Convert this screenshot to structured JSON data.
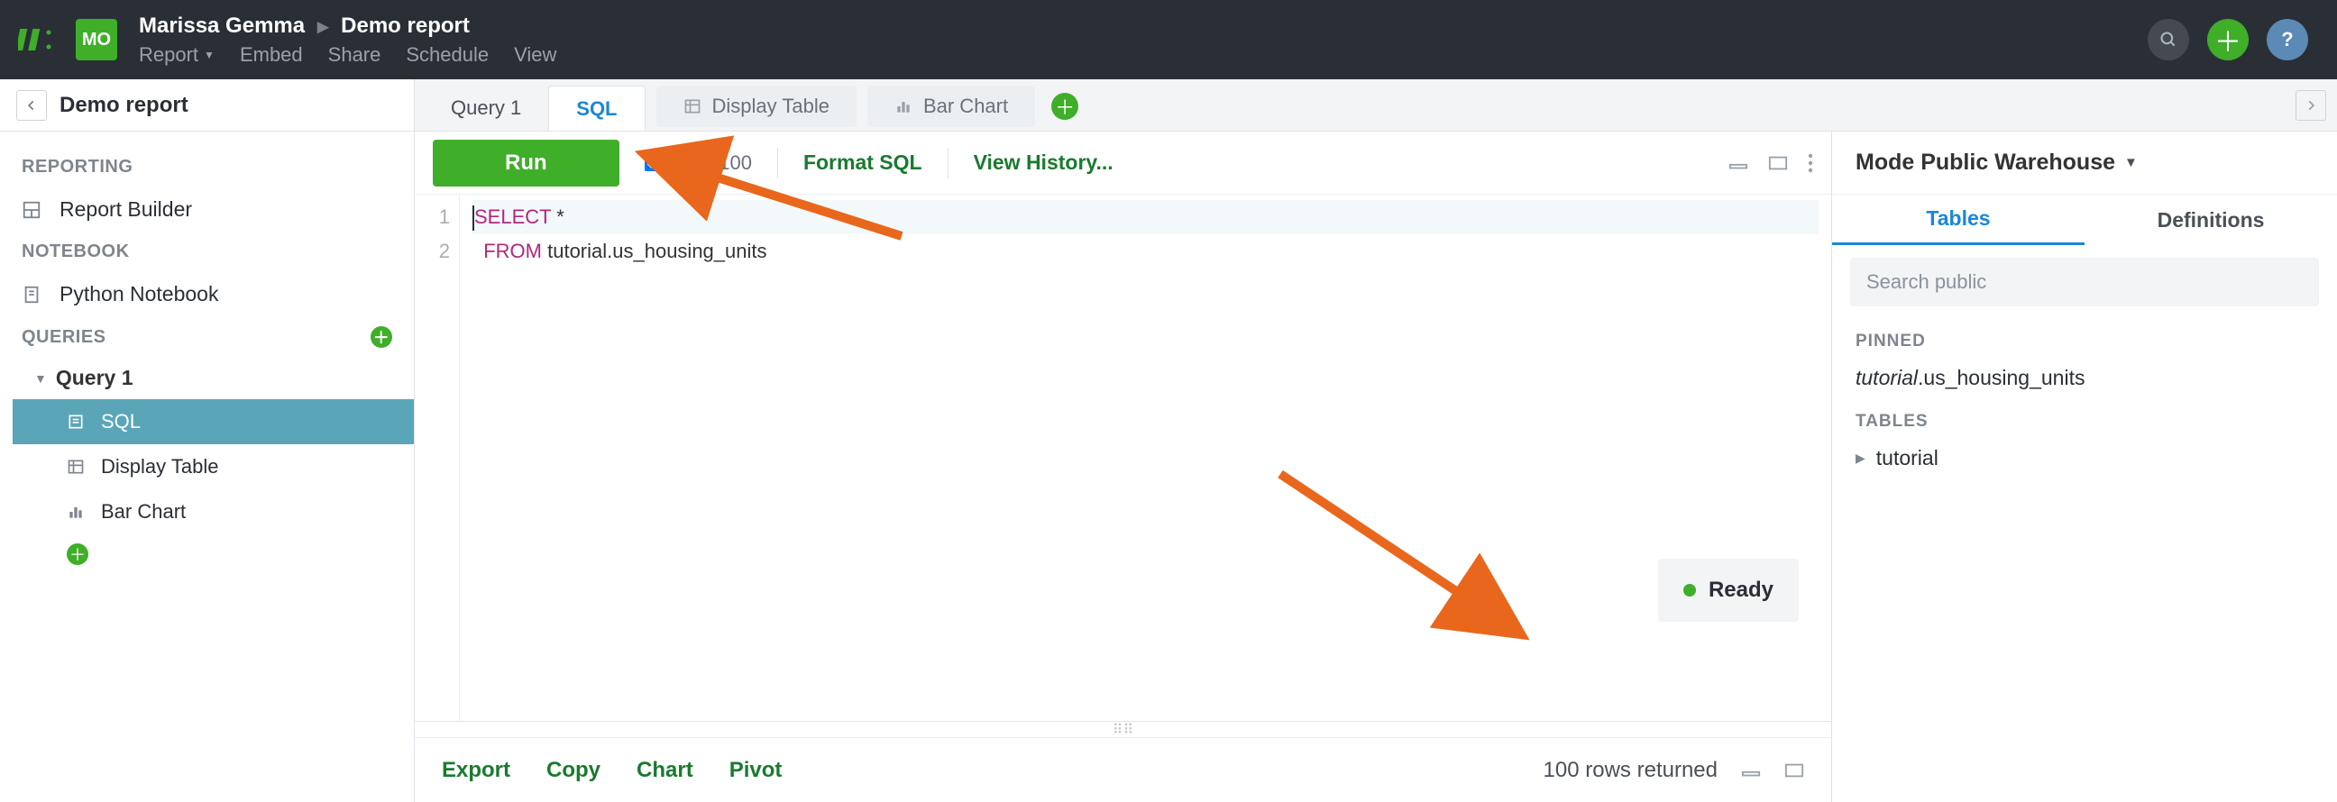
{
  "header": {
    "avatar_initials": "MO",
    "user_name": "Marissa Gemma",
    "report_title": "Demo report",
    "menu": {
      "report": "Report",
      "embed": "Embed",
      "share": "Share",
      "schedule": "Schedule",
      "view": "View"
    }
  },
  "subbar": {
    "title": "Demo report"
  },
  "tabs": {
    "query": "Query 1",
    "sql": "SQL",
    "display_table": "Display Table",
    "bar_chart": "Bar Chart"
  },
  "sidebar": {
    "reporting_heading": "REPORTING",
    "report_builder": "Report Builder",
    "notebook_heading": "NOTEBOOK",
    "python_notebook": "Python Notebook",
    "queries_heading": "QUERIES",
    "query1": "Query 1",
    "query_children": {
      "sql": "SQL",
      "display_table": "Display Table",
      "bar_chart": "Bar Chart"
    }
  },
  "toolbar": {
    "run": "Run",
    "limit_label": "Limit 100",
    "format_sql": "Format SQL",
    "view_history": "View History..."
  },
  "editor": {
    "lines": [
      {
        "n": "1",
        "kw": "SELECT",
        "rest": " *"
      },
      {
        "n": "2",
        "indent": "  ",
        "kw": "FROM",
        "rest": " tutorial.us_housing_units"
      }
    ]
  },
  "status": {
    "ready": "Ready"
  },
  "results_bar": {
    "export": "Export",
    "copy": "Copy",
    "chart": "Chart",
    "pivot": "Pivot",
    "rows_returned": "100 rows returned"
  },
  "rightpanel": {
    "datasource": "Mode Public Warehouse",
    "tabs": {
      "tables": "Tables",
      "definitions": "Definitions"
    },
    "search_placeholder": "Search public",
    "pinned_heading": "PINNED",
    "pinned_item_prefix": "tutorial",
    "pinned_item_suffix": ".us_housing_units",
    "tables_heading": "TABLES",
    "table_item": "tutorial"
  }
}
